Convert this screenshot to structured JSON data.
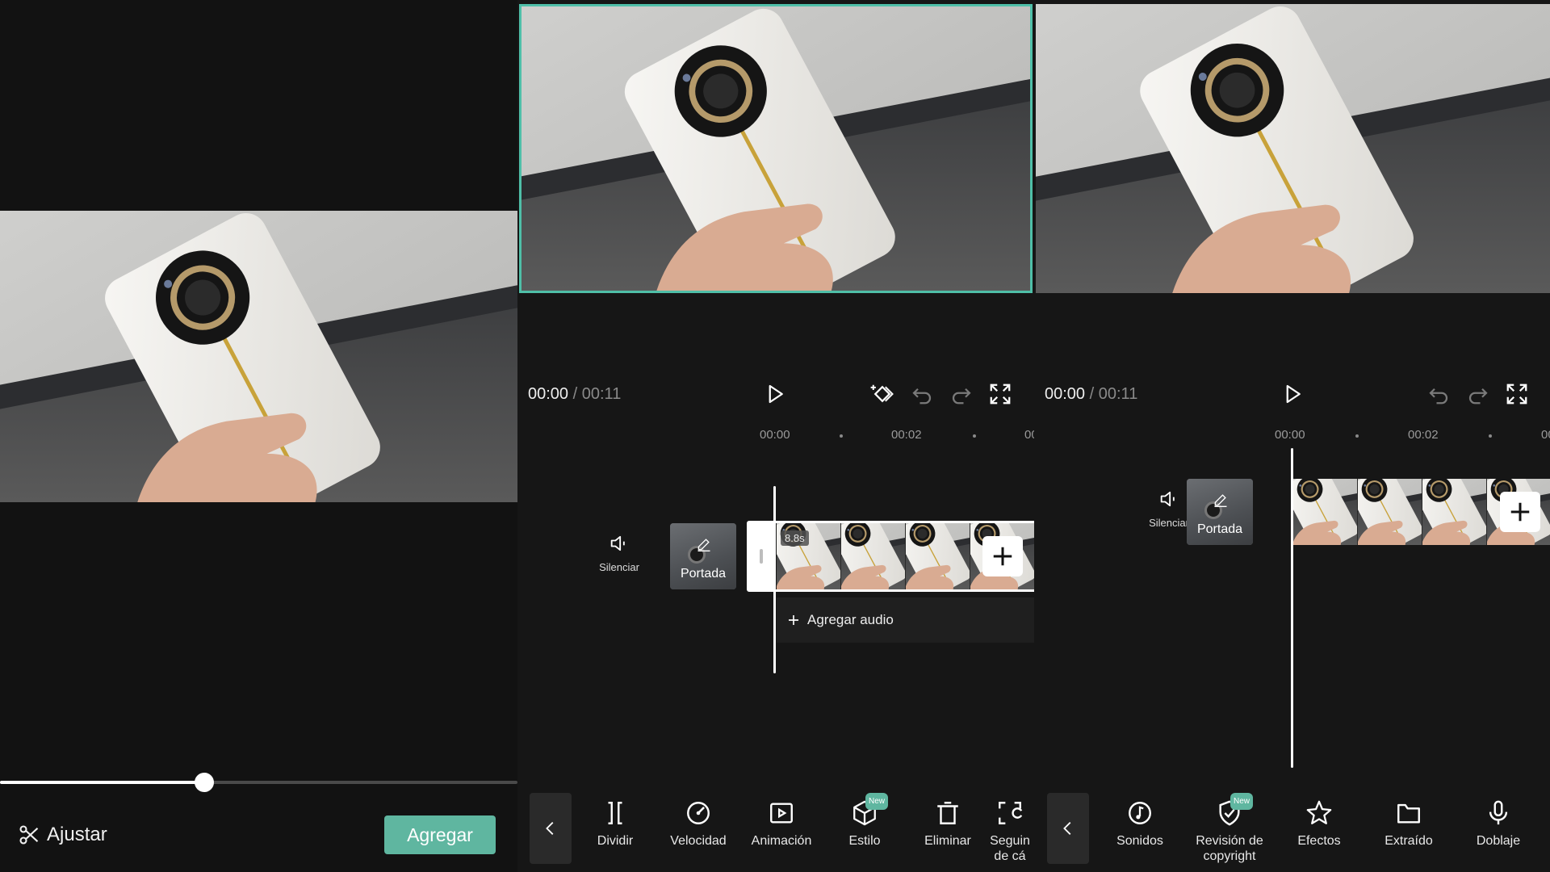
{
  "panel_left": {
    "slider_value_fraction": 0.395,
    "trim_label": "Ajustar",
    "add_button": "Agregar"
  },
  "panel_middle": {
    "time_current": "00:00",
    "time_separator": "/",
    "time_total": "00:11",
    "ruler": {
      "t0": "00:00",
      "t1": "00:02",
      "t2": "00"
    },
    "mute_label": "Silenciar",
    "cover_label": "Portada",
    "clip_duration": "8.8s",
    "add_audio": "Agregar audio",
    "tools": [
      {
        "label": "Dividir",
        "icon": "split-icon"
      },
      {
        "label": "Velocidad",
        "icon": "speed-icon"
      },
      {
        "label": "Animación",
        "icon": "animation-icon"
      },
      {
        "label": "Estilo",
        "icon": "cube-icon",
        "badge": "New"
      },
      {
        "label": "Eliminar",
        "icon": "trash-icon"
      },
      {
        "label": "Seguin\nde cá",
        "icon": "camera-track-icon"
      }
    ]
  },
  "panel_right": {
    "time_current": "00:00",
    "time_separator": "/",
    "time_total": "00:11",
    "ruler": {
      "t0": "00:00",
      "t1": "00:02",
      "t2": "00"
    },
    "mute_label": "Silenciar",
    "cover_label": "Portada",
    "tools": [
      {
        "label": "Sonidos",
        "icon": "music-note-icon"
      },
      {
        "label": "Revisión de\ncopyright",
        "icon": "shield-check-icon",
        "badge": "New"
      },
      {
        "label": "Efectos",
        "icon": "star-icon"
      },
      {
        "label": "Extraído",
        "icon": "folder-icon"
      },
      {
        "label": "Doblaje",
        "icon": "microphone-icon"
      }
    ]
  },
  "colors": {
    "accent": "#5fb6a0",
    "selection_border": "#4fbfa8",
    "background": "#121212"
  }
}
